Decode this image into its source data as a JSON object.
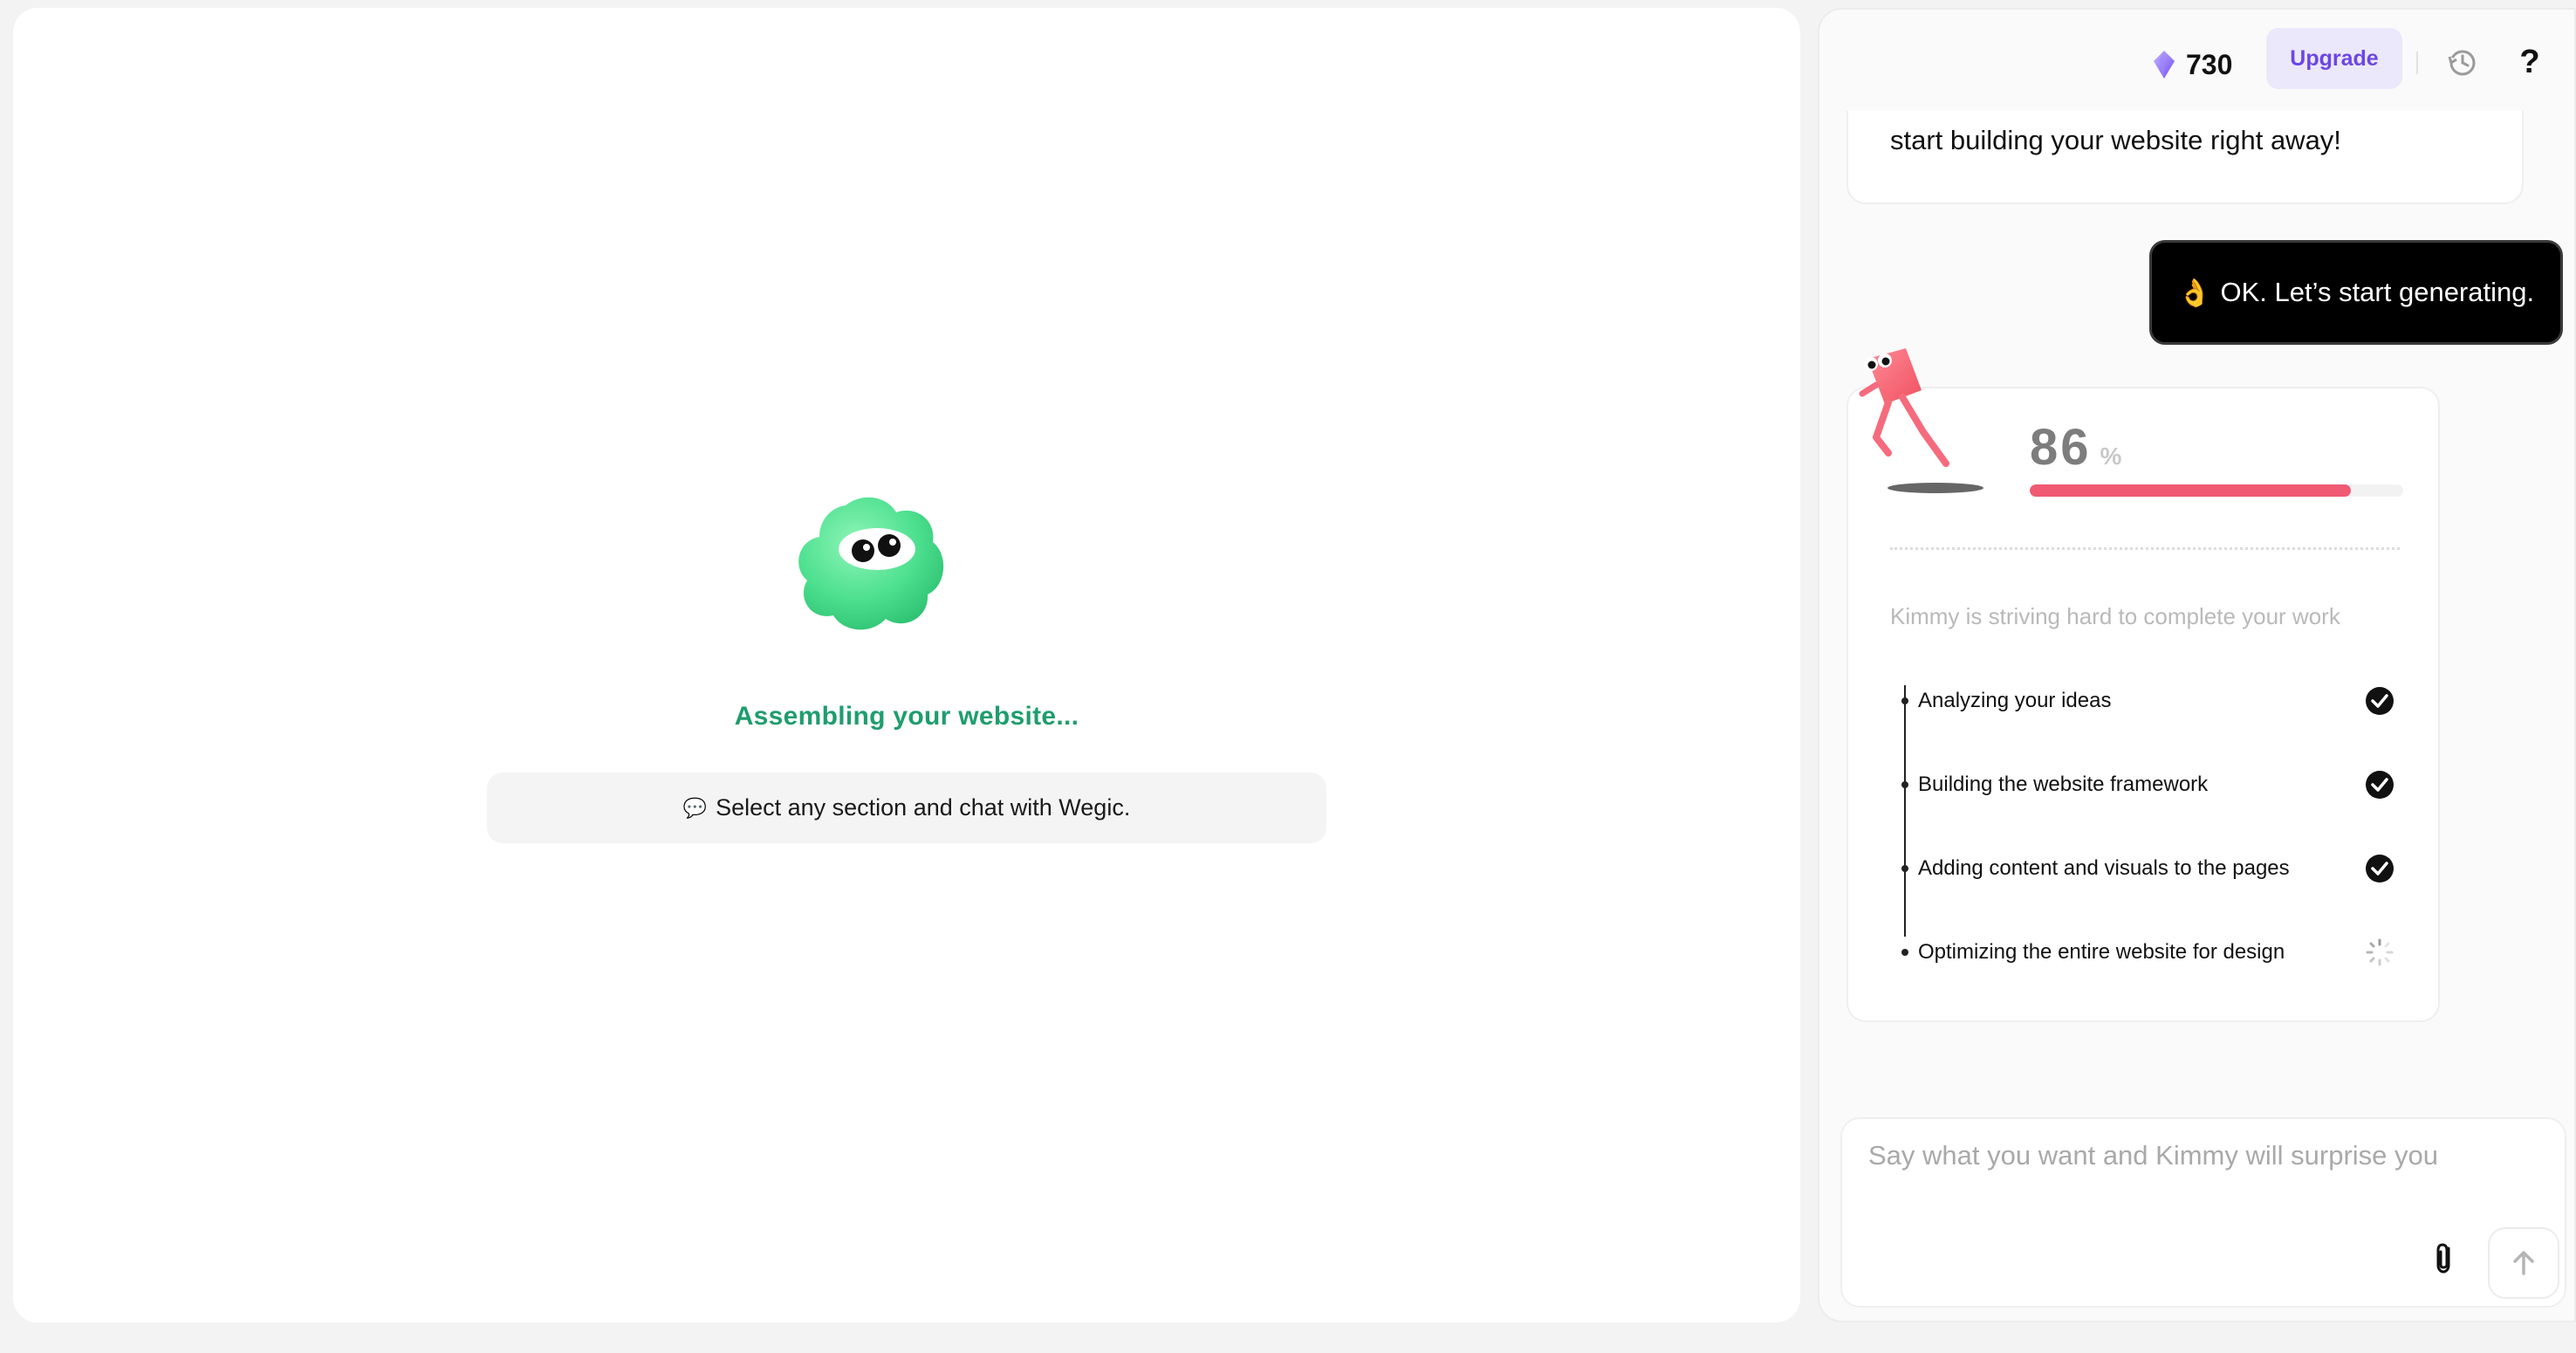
{
  "preview": {
    "status_text": "Assembling your website...",
    "hint_icon": "speech-bubble-icon",
    "hint_glyph": "💬",
    "hint_text": "Select any section and chat with Wegic.",
    "colors": {
      "status_text": "#1f9d6f",
      "blob": "#4de08f"
    }
  },
  "topbar": {
    "credits_icon": "gem-icon",
    "credits": "730",
    "upgrade_label": "Upgrade",
    "history_icon": "history-icon",
    "help_glyph": "?"
  },
  "chat": {
    "assistant_message": "start building your website right away!",
    "user_message": {
      "emoji": "👌",
      "text": "OK. Let’s start generating."
    },
    "progress": {
      "percent": "86",
      "percent_symbol": "%",
      "fraction": 0.86,
      "striving_text": "Kimmy is striving hard to complete your work",
      "steps": [
        {
          "label": "Analyzing your ideas",
          "status": "done"
        },
        {
          "label": "Building the website framework",
          "status": "done"
        },
        {
          "label": "Adding content and visuals to the pages",
          "status": "done"
        },
        {
          "label": "Optimizing the entire website for design",
          "status": "loading"
        }
      ],
      "colors": {
        "bar": "#f05a72",
        "mascot": "#f56b7d"
      }
    },
    "composer": {
      "placeholder": "Say what you want and Kimmy will surprise you",
      "value": ""
    }
  },
  "colors": {
    "upgrade_bg": "#ece8fb",
    "upgrade_text": "#6b46e5",
    "accent_dark": "#000000"
  }
}
